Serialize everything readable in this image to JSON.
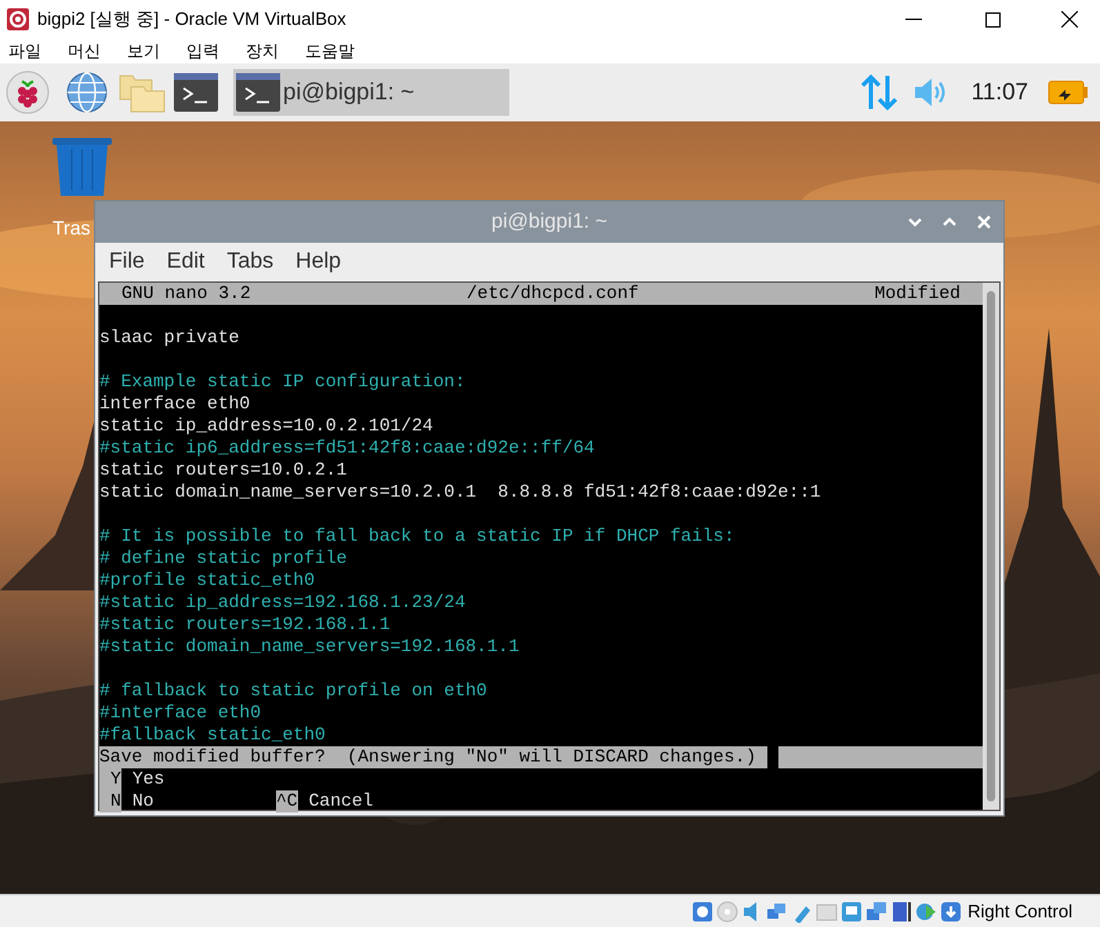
{
  "window": {
    "title": "bigpi2 [실행 중] - Oracle VM VirtualBox"
  },
  "menu": [
    "파일",
    "머신",
    "보기",
    "입력",
    "장치",
    "도움말"
  ],
  "panel": {
    "task": {
      "label": "pi@bigpi1: ~",
      "selected": true
    },
    "clock": "11:07"
  },
  "desktop": {
    "trash_label": "Tras"
  },
  "terminal": {
    "title": "pi@bigpi1: ~",
    "menu": [
      "File",
      "Edit",
      "Tabs",
      "Help"
    ],
    "header": {
      "app": "GNU nano 3.2",
      "file": "/etc/dhcpcd.conf",
      "state": "Modified"
    },
    "lines": [
      {
        "kind": "blank"
      },
      {
        "kind": "code",
        "text": "slaac private"
      },
      {
        "kind": "blank"
      },
      {
        "kind": "comment",
        "text": "# Example static IP configuration:"
      },
      {
        "kind": "code",
        "text": "interface eth0"
      },
      {
        "kind": "code",
        "text": "static ip_address=10.0.2.101/24"
      },
      {
        "kind": "comment",
        "text": "#static ip6_address=fd51:42f8:caae:d92e::ff/64"
      },
      {
        "kind": "code",
        "text": "static routers=10.0.2.1"
      },
      {
        "kind": "code",
        "text": "static domain_name_servers=10.2.0.1  8.8.8.8 fd51:42f8:caae:d92e::1"
      },
      {
        "kind": "blank"
      },
      {
        "kind": "comment",
        "text": "# It is possible to fall back to a static IP if DHCP fails:"
      },
      {
        "kind": "comment",
        "text": "# define static profile"
      },
      {
        "kind": "comment",
        "text": "#profile static_eth0"
      },
      {
        "kind": "comment",
        "text": "#static ip_address=192.168.1.23/24"
      },
      {
        "kind": "comment",
        "text": "#static routers=192.168.1.1"
      },
      {
        "kind": "comment",
        "text": "#static domain_name_servers=192.168.1.1"
      },
      {
        "kind": "blank"
      },
      {
        "kind": "comment",
        "text": "# fallback to static profile on eth0"
      },
      {
        "kind": "comment",
        "text": "#interface eth0"
      },
      {
        "kind": "comment",
        "text": "#fallback static_eth0"
      }
    ],
    "prompt": "Save modified buffer?  (Answering \"No\" will DISCARD changes.)",
    "options": [
      [
        {
          "key": "Y",
          "label": "Yes"
        }
      ],
      [
        {
          "key": "N",
          "label": "No"
        },
        {
          "key": "^C",
          "label": "Cancel"
        }
      ]
    ]
  },
  "status_bar": {
    "host_key": "Right Control"
  }
}
